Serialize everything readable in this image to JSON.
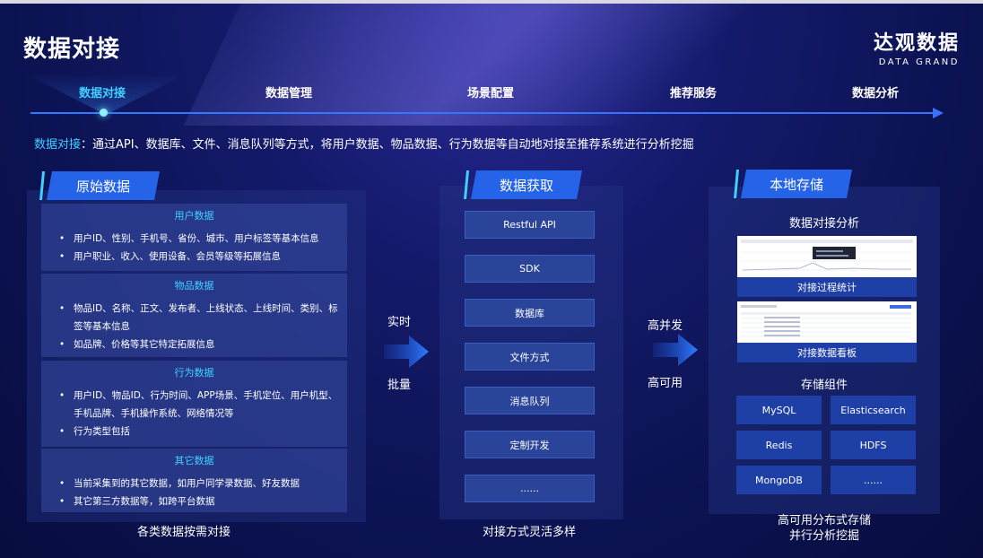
{
  "title": "数据对接",
  "logo": {
    "cn": "达观数据",
    "en": "DATA GRAND"
  },
  "timeline": [
    "数据对接",
    "数据管理",
    "场景配置",
    "推荐服务",
    "数据分析"
  ],
  "description": {
    "highlight": "数据对接",
    "text": "：通过API、数据库、文件、消息队列等方式，将用户数据、物品数据、行为数据等自动地对接至推荐系统进行分析挖掘"
  },
  "left": {
    "tag": "原始数据",
    "sections": [
      {
        "title": "用户数据",
        "items": [
          "用户ID、性别、手机号、省份、城市、用户标签等基本信息",
          "用户职业、收入、使用设备、会员等级等拓展信息"
        ]
      },
      {
        "title": "物品数据",
        "items": [
          "物品ID、名称、正文、发布者、上线状态、上线时间、类别、标签等基本信息",
          "如品牌、价格等其它特定拓展信息"
        ]
      },
      {
        "title": "行为数据",
        "items": [
          "用户ID、物品ID、行为时间、APP场景、手机定位、用户机型、手机品牌、手机操作系统、网络情况等",
          "行为类型包括"
        ]
      },
      {
        "title": "其它数据",
        "items": [
          "当前采集到的其它数据，如用户同学录数据、好友数据",
          "其它第三方数据等，如跨平台数据"
        ]
      }
    ],
    "caption": "各类数据按需对接"
  },
  "arrow1": {
    "top": "实时",
    "bottom": "批量"
  },
  "middle": {
    "tag": "数据获取",
    "items": [
      "Restful API",
      "SDK",
      "数据库",
      "文件方式",
      "消息队列",
      "定制开发",
      "......"
    ],
    "caption": "对接方式灵活多样"
  },
  "arrow2": {
    "top": "高并发",
    "bottom": "高可用"
  },
  "right": {
    "tag": "本地存储",
    "analysis_title": "数据对接分析",
    "screens": [
      "对接过程统计",
      "对接数据看板"
    ],
    "storage_title": "存储组件",
    "storage": [
      "MySQL",
      "Elasticsearch",
      "Redis",
      "HDFS",
      "MongoDB",
      "......"
    ],
    "caption_line1": "高可用分布式存储",
    "caption_line2": "并行分析挖掘"
  },
  "colors": {
    "accent": "#3fd0ff",
    "tag": "#2563e8",
    "panel_button": "#2a4499",
    "storage_button": "#1e3fa6"
  }
}
